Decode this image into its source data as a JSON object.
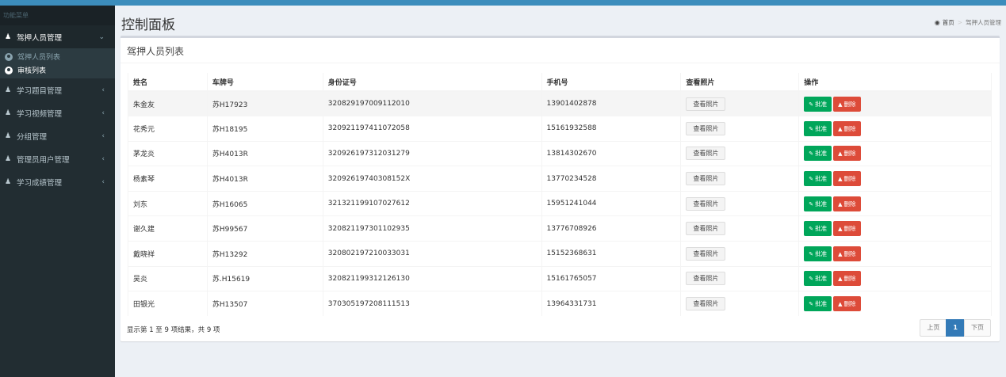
{
  "colors": {
    "topbar": "#3c8dbc",
    "sidebar": "#222d32",
    "approve": "#00a65a",
    "delete": "#dd4b39",
    "page_active": "#337ab7"
  },
  "sidebar": {
    "header": "功能菜单",
    "escort_group": {
      "label": "驾押人员管理",
      "icon": "users-icon",
      "sub": [
        {
          "label": "驾押人员列表",
          "icon": "circle-icon"
        },
        {
          "label": "审核列表",
          "icon": "circle-icon"
        }
      ]
    },
    "items": [
      {
        "label": "学习题目管理",
        "icon": "users-icon"
      },
      {
        "label": "学习视频管理",
        "icon": "users-icon"
      },
      {
        "label": "分组管理",
        "icon": "users-icon"
      },
      {
        "label": "管理员用户管理",
        "icon": "users-icon"
      },
      {
        "label": "学习成绩管理",
        "icon": "users-icon"
      }
    ]
  },
  "header": {
    "title": "控制面板",
    "breadcrumb": {
      "home": "首页",
      "current": "驾押人员管理"
    }
  },
  "box": {
    "title": "驾押人员列表",
    "columns": [
      "姓名",
      "车牌号",
      "身份证号",
      "手机号",
      "查看照片",
      "操作"
    ],
    "photo_label": "查看照片",
    "approve_label": "批准",
    "delete_label": "删除",
    "rows": [
      {
        "name": "朱金友",
        "plate": "苏H17923",
        "id": "320829197009112010",
        "phone": "13901402878"
      },
      {
        "name": "花秀元",
        "plate": "苏H18195",
        "id": "32092119741107205​8",
        "phone": "15161932588"
      },
      {
        "name": "茅龙炎",
        "plate": "苏H4013R",
        "id": "320926197312031279",
        "phone": "13814302670"
      },
      {
        "name": "杨素琴",
        "plate": "苏H4013R",
        "id": "32092619740308152X",
        "phone": "13770234528"
      },
      {
        "name": "刘东",
        "plate": "苏H16065",
        "id": "321321199107027612",
        "phone": "15951241044"
      },
      {
        "name": "谢久建",
        "plate": "苏H99567",
        "id": "320821197301102935",
        "phone": "13776708926"
      },
      {
        "name": "戴晓祥",
        "plate": "苏H13292",
        "id": "320802197210033031",
        "phone": "15152368631"
      },
      {
        "name": "吴炎",
        "plate": "苏.H15619",
        "id": "320821199312126130",
        "phone": "15161765057"
      },
      {
        "name": "田银光",
        "plate": "苏H13507",
        "id": "370305197208111513",
        "phone": "13964331731"
      }
    ],
    "footer_info": "显示第 1 至 9 项结果，共 9 项",
    "pagination": {
      "prev": "上页",
      "current": "1",
      "next": "下页"
    }
  }
}
